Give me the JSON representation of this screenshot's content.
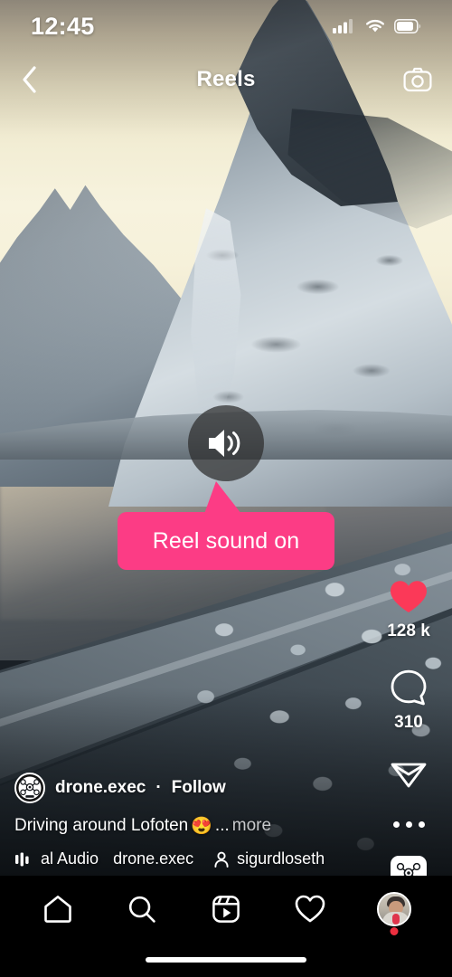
{
  "status_bar": {
    "time": "12:45",
    "cellular_icon": "cellular-signal-icon",
    "wifi_icon": "wifi-icon",
    "battery_icon": "battery-icon",
    "battery_level_pct": 75
  },
  "header": {
    "back_icon": "chevron-left-icon",
    "title": "Reels",
    "camera_icon": "camera-icon"
  },
  "sound_toggle": {
    "icon": "speaker-on-icon",
    "state": "on",
    "callout_text": "Reel sound on",
    "callout_color": "#FC3C85"
  },
  "actions": {
    "like": {
      "icon": "heart-filled-icon",
      "count": "128 k",
      "liked": true,
      "color": "#FB3958"
    },
    "comment": {
      "icon": "comment-bubble-icon",
      "count": "310"
    },
    "share": {
      "icon": "share-paper-plane-icon"
    },
    "more": {
      "icon": "more-options-icon"
    },
    "audio_thumbnail": {
      "icon": "audio-album-drone-icon"
    }
  },
  "post": {
    "avatar_icon": "drone-exec-avatar-icon",
    "username": "drone.exec",
    "separator": "·",
    "follow_label": "Follow",
    "caption": "Driving around Lofoten",
    "caption_emoji": "😍",
    "caption_truncation": "...",
    "more_label": "more",
    "audio": {
      "icon": "audio-bars-icon",
      "title": "al Audio",
      "author": "drone.exec"
    },
    "tagged": {
      "icon": "person-icon",
      "username": "sigurdloseth"
    }
  },
  "tabbar": {
    "items": [
      {
        "name": "home",
        "icon": "home-icon",
        "active": true
      },
      {
        "name": "search",
        "icon": "search-icon",
        "active": false
      },
      {
        "name": "reels",
        "icon": "reels-icon",
        "active": false
      },
      {
        "name": "activity",
        "icon": "heart-outline-icon",
        "active": false
      },
      {
        "name": "profile",
        "icon": "profile-avatar-icon",
        "active": false,
        "has_notification": true
      }
    ],
    "home_indicator": "home-indicator"
  },
  "colors": {
    "accent_pink": "#FC3C85",
    "like_red": "#FB3958",
    "notification_red": "#ED2F3F",
    "background": "#000000",
    "text": "#FFFFFF"
  }
}
